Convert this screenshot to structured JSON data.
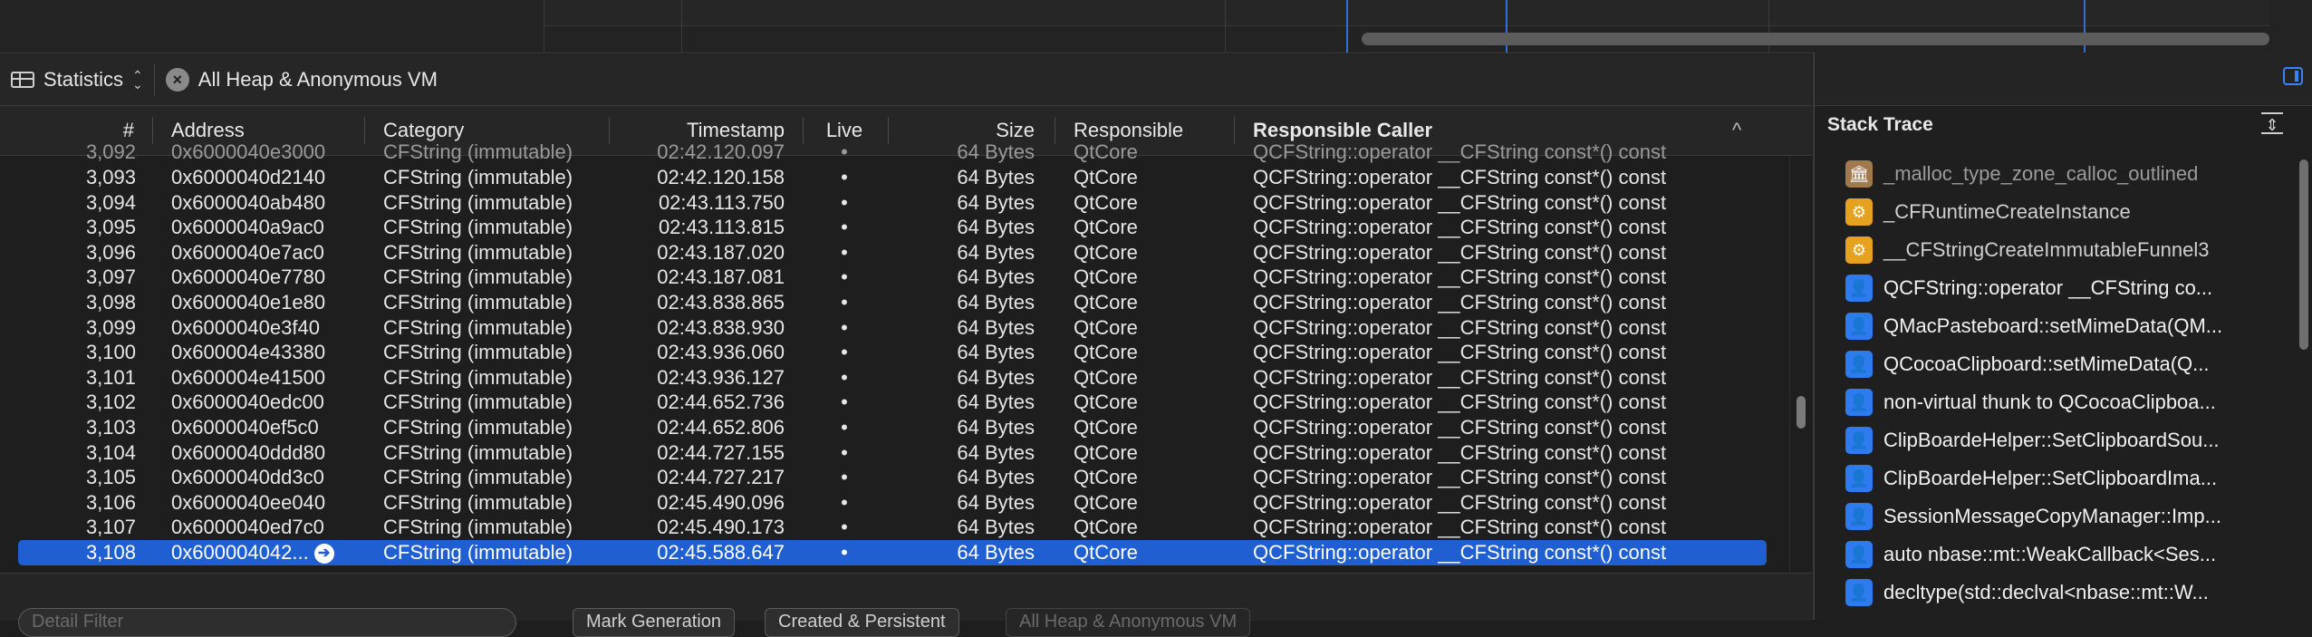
{
  "filterbar": {
    "view_label": "Statistics",
    "scope_label": "All Heap & Anonymous VM"
  },
  "table": {
    "columns": [
      "#",
      "Address",
      "Category",
      "Timestamp",
      "Live",
      "Size",
      "Responsible",
      "Responsible Caller"
    ],
    "sorted_column_indicator": "^",
    "partial_top_row": [
      "3,092",
      "0x6000040e3000",
      "CFString (immutable)",
      "02:42.120.097",
      "•",
      "64 Bytes",
      "QtCore",
      "QCFString::operator __CFString const*() const"
    ],
    "rows": [
      [
        "3,093",
        "0x6000040d2140",
        "CFString (immutable)",
        "02:42.120.158",
        "•",
        "64 Bytes",
        "QtCore",
        "QCFString::operator __CFString const*() const"
      ],
      [
        "3,094",
        "0x6000040ab480",
        "CFString (immutable)",
        "02:43.113.750",
        "•",
        "64 Bytes",
        "QtCore",
        "QCFString::operator __CFString const*() const"
      ],
      [
        "3,095",
        "0x6000040a9ac0",
        "CFString (immutable)",
        "02:43.113.815",
        "•",
        "64 Bytes",
        "QtCore",
        "QCFString::operator __CFString const*() const"
      ],
      [
        "3,096",
        "0x6000040e7ac0",
        "CFString (immutable)",
        "02:43.187.020",
        "•",
        "64 Bytes",
        "QtCore",
        "QCFString::operator __CFString const*() const"
      ],
      [
        "3,097",
        "0x6000040e7780",
        "CFString (immutable)",
        "02:43.187.081",
        "•",
        "64 Bytes",
        "QtCore",
        "QCFString::operator __CFString const*() const"
      ],
      [
        "3,098",
        "0x6000040e1e80",
        "CFString (immutable)",
        "02:43.838.865",
        "•",
        "64 Bytes",
        "QtCore",
        "QCFString::operator __CFString const*() const"
      ],
      [
        "3,099",
        "0x6000040e3f40",
        "CFString (immutable)",
        "02:43.838.930",
        "•",
        "64 Bytes",
        "QtCore",
        "QCFString::operator __CFString const*() const"
      ],
      [
        "3,100",
        "0x600004e43380",
        "CFString (immutable)",
        "02:43.936.060",
        "•",
        "64 Bytes",
        "QtCore",
        "QCFString::operator __CFString const*() const"
      ],
      [
        "3,101",
        "0x600004e41500",
        "CFString (immutable)",
        "02:43.936.127",
        "•",
        "64 Bytes",
        "QtCore",
        "QCFString::operator __CFString const*() const"
      ],
      [
        "3,102",
        "0x6000040edc00",
        "CFString (immutable)",
        "02:44.652.736",
        "•",
        "64 Bytes",
        "QtCore",
        "QCFString::operator __CFString const*() const"
      ],
      [
        "3,103",
        "0x6000040ef5c0",
        "CFString (immutable)",
        "02:44.652.806",
        "•",
        "64 Bytes",
        "QtCore",
        "QCFString::operator __CFString const*() const"
      ],
      [
        "3,104",
        "0x6000040ddd80",
        "CFString (immutable)",
        "02:44.727.155",
        "•",
        "64 Bytes",
        "QtCore",
        "QCFString::operator __CFString const*() const"
      ],
      [
        "3,105",
        "0x6000040dd3c0",
        "CFString (immutable)",
        "02:44.727.217",
        "•",
        "64 Bytes",
        "QtCore",
        "QCFString::operator __CFString const*() const"
      ],
      [
        "3,106",
        "0x6000040ee040",
        "CFString (immutable)",
        "02:45.490.096",
        "•",
        "64 Bytes",
        "QtCore",
        "QCFString::operator __CFString const*() const"
      ],
      [
        "3,107",
        "0x6000040ed7c0",
        "CFString (immutable)",
        "02:45.490.173",
        "•",
        "64 Bytes",
        "QtCore",
        "QCFString::operator __CFString const*() const"
      ]
    ],
    "selected_row": [
      "3,108",
      "0x600004042...",
      "CFString (immutable)",
      "02:45.588.647",
      "•",
      "64 Bytes",
      "QtCore",
      "QCFString::operator __CFString const*() const"
    ]
  },
  "bottombar": {
    "detail_filter_placeholder": "Detail Filter",
    "mark_generation": "Mark Generation",
    "created_persistent": "Created & Persistent",
    "scope_dim": "All Heap & Anonymous VM"
  },
  "inspector": {
    "title": "Stack Trace",
    "frames": [
      {
        "label": "_malloc_type_zone_calloc_outlined",
        "kind": "lib",
        "icon": "library-icon"
      },
      {
        "label": "_CFRuntimeCreateInstance",
        "kind": "sys",
        "icon": "framework-icon"
      },
      {
        "label": "__CFStringCreateImmutableFunnel3",
        "kind": "sys",
        "icon": "framework-icon"
      },
      {
        "label": "QCFString::operator __CFString co...",
        "kind": "user",
        "icon": "user-icon"
      },
      {
        "label": "QMacPasteboard::setMimeData(QM...",
        "kind": "user",
        "icon": "user-icon"
      },
      {
        "label": "QCocoaClipboard::setMimeData(Q...",
        "kind": "user",
        "icon": "user-icon"
      },
      {
        "label": "non-virtual thunk to QCocoaClipboa...",
        "kind": "user",
        "icon": "user-icon"
      },
      {
        "label": "ClipBoardeHelper::SetClipboardSou...",
        "kind": "user",
        "icon": "user-icon"
      },
      {
        "label": "ClipBoardeHelper::SetClipboardIma...",
        "kind": "user",
        "icon": "user-icon"
      },
      {
        "label": "SessionMessageCopyManager::Imp...",
        "kind": "user",
        "icon": "user-icon"
      },
      {
        "label": "auto nbase::mt::WeakCallback<Ses...",
        "kind": "user",
        "icon": "user-icon"
      },
      {
        "label": "decltype(std::declval<nbase::mt::W...",
        "kind": "user",
        "icon": "user-icon"
      }
    ]
  },
  "colors": {
    "selection": "#1f5fd1",
    "accent": "#3b82f6",
    "lib_icon": "#a07a4d",
    "sys_icon": "#e6a11f",
    "user_icon": "#2e7bf0"
  }
}
